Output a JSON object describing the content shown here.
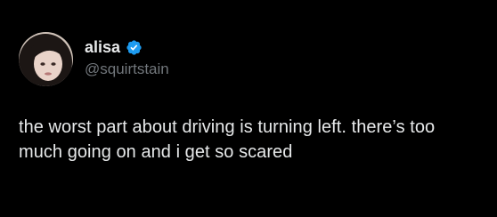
{
  "author": {
    "display_name": "alisa",
    "handle": "@squirtstain",
    "verified_icon": "verified-badge-icon",
    "badge_color": "#1d9bf0"
  },
  "tweet": {
    "text": "the worst part about driving is turning left. there’s too much going on and i get so scared"
  },
  "theme": {
    "background": "#000000",
    "text": "#e7e9ea",
    "secondary_text": "#71767b"
  }
}
